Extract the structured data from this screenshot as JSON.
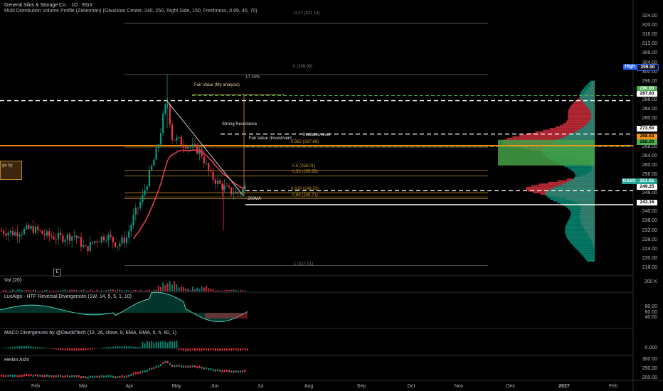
{
  "header": {
    "title": "General Silos & Storage Co. · 1D · EGX",
    "indicator": "Multi Distribution Volume Profile (Zeiierman) (Gaussian Center, 240, 250, Right Side, 150, Freshness, 0.99, 40, 70)"
  },
  "price_axis": {
    "labels": [
      "324.00",
      "320.00",
      "316.00",
      "312.00",
      "308.00",
      "304.00",
      "300.00",
      "296.00",
      "292.00",
      "288.00",
      "284.00",
      "280.00",
      "276.00",
      "272.00",
      "268.00",
      "264.00",
      "260.00",
      "256.00",
      "252.00",
      "248.00",
      "244.00",
      "240.00",
      "236.00",
      "232.00",
      "228.00",
      "224.00",
      "220.00",
      "216.00"
    ]
  },
  "price_tags": {
    "high_label": "High",
    "high_value": "299.00",
    "level_290": "290.00",
    "level_287": "287.83",
    "level_273": "273.50",
    "level_268_53": "268.53",
    "level_268": "268.00",
    "symbol": "GSSC",
    "last_price": "251.85",
    "level_249": "249.25",
    "level_243": "243.16"
  },
  "annotations": {
    "pct_change": "17.24%",
    "fair_value_mine": "Fair Value (My analysis)",
    "strong_resistance": "Strong Resistance",
    "fair_value_investment": "Fair Value (Investment ...",
    "institutes_level": "Institutes level",
    "ma200": "200MA",
    "side_box": "ge by",
    "e_marker": "E"
  },
  "fib_levels": {
    "f027": "-0.27 (321.14)",
    "f0": "0 (299.00)",
    "f382": "0.382 (267.88)",
    "f05": "0.5 (258.01)",
    "f053": "0.53 (255.55)",
    "f618": "0.618 (248.33)",
    "f065": "0.65 (245.71)",
    "f1": "1 (217.01)"
  },
  "panes": {
    "volume": {
      "label": "Vol (20)",
      "axis": [
        "200 K"
      ]
    },
    "luxalgo": {
      "label": "LuxAlgo - HTF Reversal Divergences (1W, 14, 5, 5, 1, 10)",
      "axis": [
        "80.00",
        "60.00",
        "40.00"
      ]
    },
    "macd": {
      "label": "MACD Divergences by @DavddTech (12, 26, close, 9, EMA, EMA, 5, 5, 60, 1)",
      "axis": [
        "0.000"
      ]
    },
    "heikin": {
      "label": "Heikin Ashi",
      "axis": [
        "300.00",
        "250.00",
        "200.00"
      ]
    }
  },
  "time_axis": {
    "labels": [
      "Feb",
      "Mar",
      "Apr",
      "May",
      "Jun",
      "Jul",
      "Aug",
      "Sep",
      "Oct",
      "Nov",
      "Dec",
      "2027",
      "Feb"
    ]
  },
  "colors": {
    "up": "#089981",
    "down": "#f23645",
    "fib": "#c8962e",
    "orange_line": "#f7931a",
    "green_level": "#4caf50",
    "ema_red": "#e53950",
    "high_tag": "#2962ff",
    "symbol_tag": "#26a69a"
  }
}
